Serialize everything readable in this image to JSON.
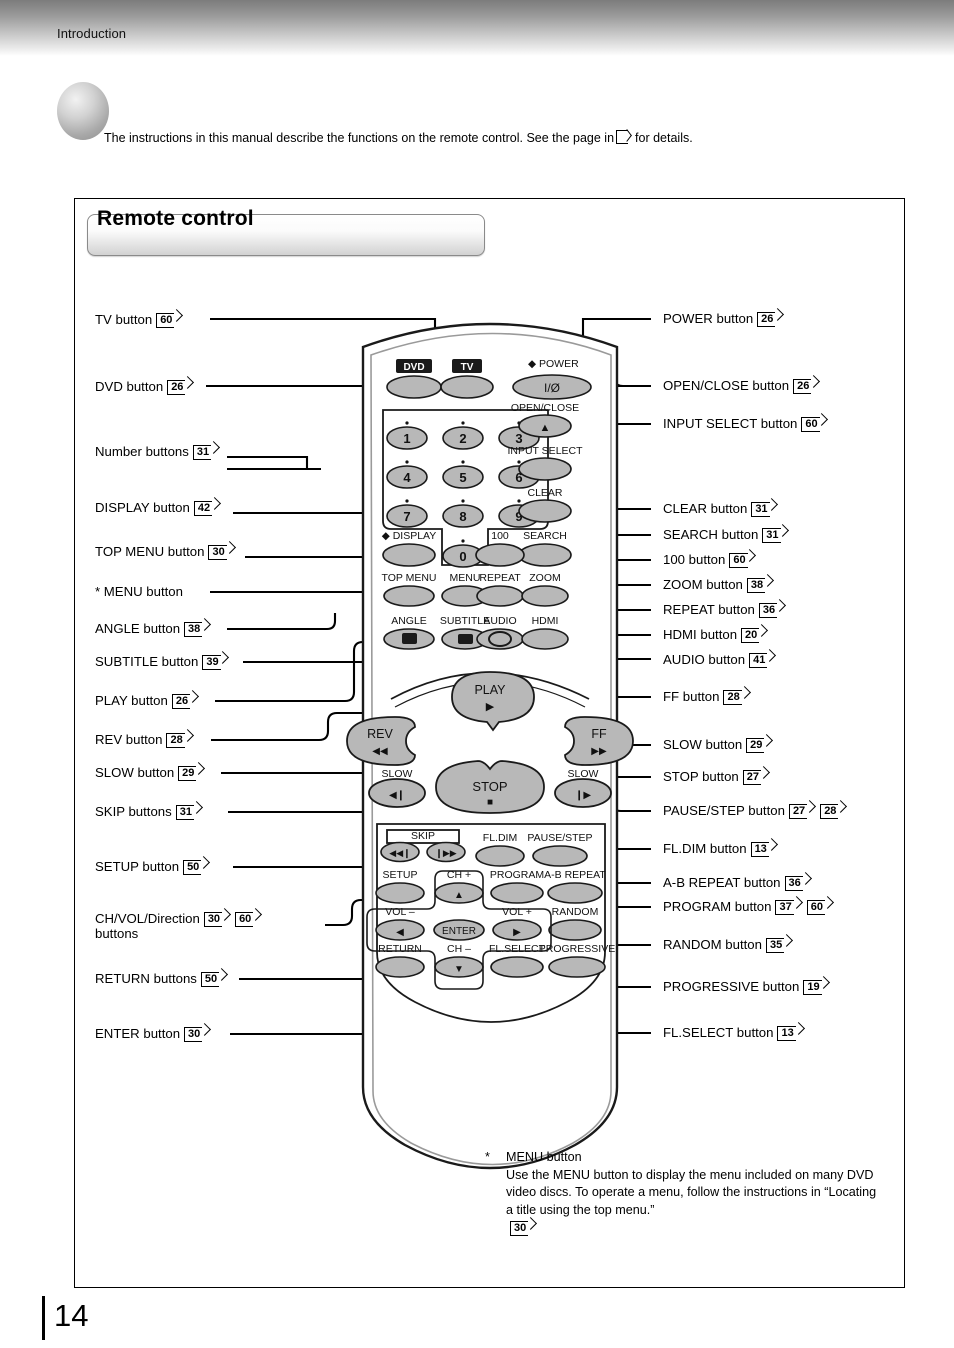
{
  "header": {
    "section": "Introduction"
  },
  "intro": {
    "text_before": "The instructions in this manual describe the functions on the remote control. See the page in",
    "text_after": "for details.",
    "bullet_icon": "gray-sphere-icon"
  },
  "section": {
    "title": "Remote control"
  },
  "labels_left": [
    {
      "text": "TV button",
      "pages": [
        "60"
      ]
    },
    {
      "text": "DVD button",
      "pages": [
        "26"
      ]
    },
    {
      "text": "Number buttons",
      "pages": [
        "31"
      ]
    },
    {
      "text": "DISPLAY button",
      "pages": [
        "42"
      ]
    },
    {
      "text": "TOP MENU button",
      "pages": [
        "30"
      ]
    },
    {
      "text": "* MENU button",
      "pages": []
    },
    {
      "text": "ANGLE button",
      "pages": [
        "38"
      ]
    },
    {
      "text": "SUBTITLE button",
      "pages": [
        "39"
      ]
    },
    {
      "text": "PLAY button",
      "pages": [
        "26"
      ]
    },
    {
      "text": "REV button",
      "pages": [
        "28"
      ]
    },
    {
      "text": "SLOW button",
      "pages": [
        "29"
      ]
    },
    {
      "text": "SKIP buttons",
      "pages": [
        "31"
      ]
    },
    {
      "text": "SETUP button",
      "pages": [
        "50"
      ]
    },
    {
      "text": "CH/VOL/Direction",
      "text2": "buttons",
      "pages": [
        "30",
        "60"
      ]
    },
    {
      "text": "RETURN buttons",
      "pages": [
        "50"
      ]
    },
    {
      "text": "ENTER button",
      "pages": [
        "30"
      ]
    }
  ],
  "labels_right": [
    {
      "text": "POWER button",
      "pages": [
        "26"
      ]
    },
    {
      "text": "OPEN/CLOSE button",
      "pages": [
        "26"
      ]
    },
    {
      "text": "INPUT SELECT button",
      "pages": [
        "60"
      ]
    },
    {
      "text": "CLEAR button",
      "pages": [
        "31"
      ]
    },
    {
      "text": "SEARCH button",
      "pages": [
        "31"
      ]
    },
    {
      "text": "100 button",
      "pages": [
        "60"
      ]
    },
    {
      "text": "ZOOM button",
      "pages": [
        "38"
      ]
    },
    {
      "text": "REPEAT button",
      "pages": [
        "36"
      ]
    },
    {
      "text": "HDMI button",
      "pages": [
        "20"
      ]
    },
    {
      "text": "AUDIO button",
      "pages": [
        "41"
      ]
    },
    {
      "text": "FF button",
      "pages": [
        "28"
      ]
    },
    {
      "text": "SLOW button",
      "pages": [
        "29"
      ]
    },
    {
      "text": "STOP button",
      "pages": [
        "27"
      ]
    },
    {
      "text": "PAUSE/STEP button",
      "pages": [
        "27",
        "28"
      ]
    },
    {
      "text": "FL.DIM button",
      "pages": [
        "13"
      ]
    },
    {
      "text": "A-B REPEAT button",
      "pages": [
        "36"
      ]
    },
    {
      "text": "PROGRAM button",
      "pages": [
        "37",
        "60"
      ]
    },
    {
      "text": "RANDOM button",
      "pages": [
        "35"
      ]
    },
    {
      "text": "PROGRESSIVE button",
      "pages": [
        "19"
      ]
    },
    {
      "text": "FL.SELECT button",
      "pages": [
        "13"
      ]
    }
  ],
  "remote": {
    "mode_buttons": [
      "DVD",
      "TV"
    ],
    "power_label": "POWER",
    "power_glyph": "I/ø",
    "open_close_label": "OPEN/CLOSE",
    "open_close_glyph": "▲",
    "input_select_label": "INPUT SELECT",
    "clear_label": "CLEAR",
    "search_label": "SEARCH",
    "hundred_label": "100",
    "display_label": "DISPLAY",
    "numbers": [
      "1",
      "2",
      "3",
      "4",
      "5",
      "6",
      "7",
      "8",
      "9",
      "0"
    ],
    "row_top_menu": [
      "TOP MENU",
      "MENU",
      "REPEAT",
      "ZOOM"
    ],
    "row_angle": [
      "ANGLE",
      "SUBTITLE",
      "AUDIO",
      "HDMI"
    ],
    "play_label": "PLAY",
    "rev_label": "REV",
    "ff_label": "FF",
    "slow_left_label": "SLOW",
    "slow_right_label": "SLOW",
    "stop_label": "STOP",
    "skip_label": "SKIP",
    "fl_dim_label": "FL.DIM",
    "pause_step_label": "PAUSE/STEP",
    "setup_label": "SETUP",
    "ch_plus_label": "CH +",
    "ch_minus_label": "CH –",
    "vol_minus_label": "VOL –",
    "vol_plus_label": "VOL +",
    "program_label": "PROGRAM",
    "ab_repeat_label": "A-B REPEAT",
    "random_label": "RANDOM",
    "enter_label": "ENTER",
    "return_label": "RETURN",
    "fl_select_label": "FL.SELECT",
    "progressive_label": "PROGRESSIVE"
  },
  "footnote": {
    "star": "*",
    "title": "MENU button",
    "body": "Use the MENU button to display the menu included on many DVD video discs. To operate a menu, follow the instructions in “Locating a title using the top menu.”",
    "page": "30"
  },
  "page_number": "14"
}
